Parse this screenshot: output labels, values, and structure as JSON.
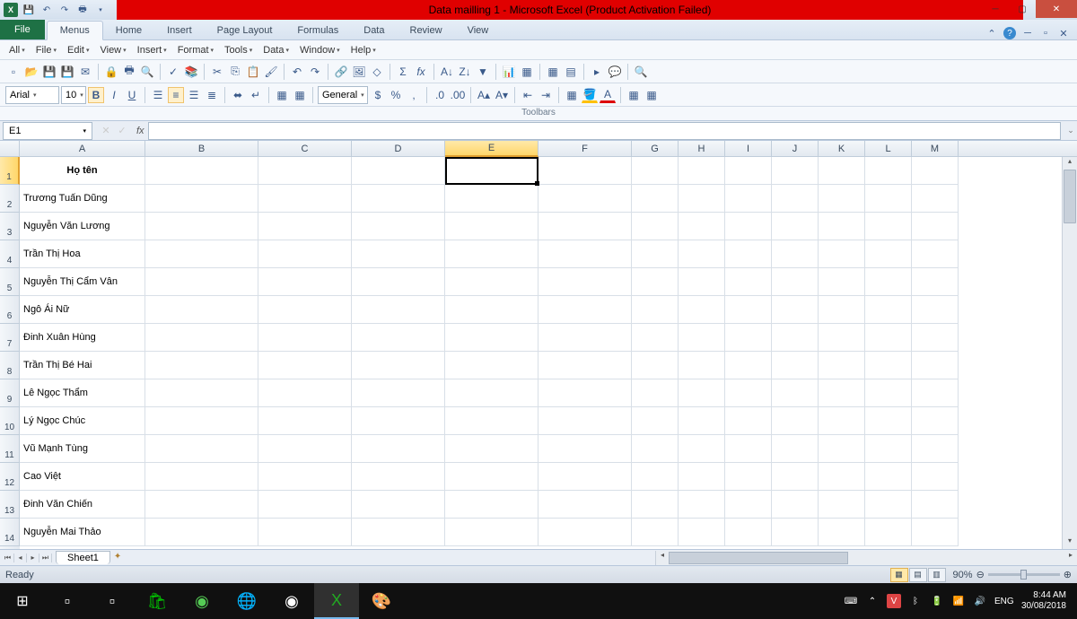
{
  "titlebar": {
    "title": "Data mailling 1 - Microsoft Excel (Product Activation Failed)"
  },
  "ribbon": {
    "tabs": {
      "file": "File",
      "menus": "Menus",
      "home": "Home",
      "insert": "Insert",
      "pagelayout": "Page Layout",
      "formulas": "Formulas",
      "data": "Data",
      "review": "Review",
      "view": "View"
    }
  },
  "classic_menu": {
    "all": "All",
    "file": "File",
    "edit": "Edit",
    "view": "View",
    "insert": "Insert",
    "format": "Format",
    "tools": "Tools",
    "data": "Data",
    "window": "Window",
    "help": "Help"
  },
  "toolbar": {
    "font_name": "Arial",
    "font_size": "10",
    "label": "Toolbars",
    "general": "General",
    "currency": "$",
    "percent": "%"
  },
  "formula": {
    "name_box": "E1",
    "fx": "fx"
  },
  "columns": [
    "A",
    "B",
    "C",
    "D",
    "E",
    "F",
    "G",
    "H",
    "I",
    "J",
    "K",
    "L",
    "M"
  ],
  "selected_column": "E",
  "selected_row": 1,
  "rows": {
    "1": {
      "A": "Họ tên"
    },
    "2": {
      "A": "Trương Tuấn Dũng"
    },
    "3": {
      "A": "Nguyễn Văn Lương"
    },
    "4": {
      "A": "Trần Thị Hoa"
    },
    "5": {
      "A": "Nguyễn Thị Cẩm Vân"
    },
    "6": {
      "A": "Ngô Ái Nữ"
    },
    "7": {
      "A": "Đinh Xuân Hùng"
    },
    "8": {
      "A": "Trần Thị Bé Hai"
    },
    "9": {
      "A": "Lê Ngọc Thẩm"
    },
    "10": {
      "A": "Lý Ngọc Chúc"
    },
    "11": {
      "A": "Vũ Mạnh Tùng"
    },
    "12": {
      "A": "Cao Việt"
    },
    "13": {
      "A": "Đinh Văn Chiến"
    },
    "14": {
      "A": "Nguyễn Mai Thảo"
    }
  },
  "sheet": {
    "name": "Sheet1"
  },
  "status": {
    "ready": "Ready",
    "zoom": "90%"
  },
  "taskbar": {
    "lang": "ENG",
    "time": "8:44 AM",
    "date": "30/08/2018"
  }
}
